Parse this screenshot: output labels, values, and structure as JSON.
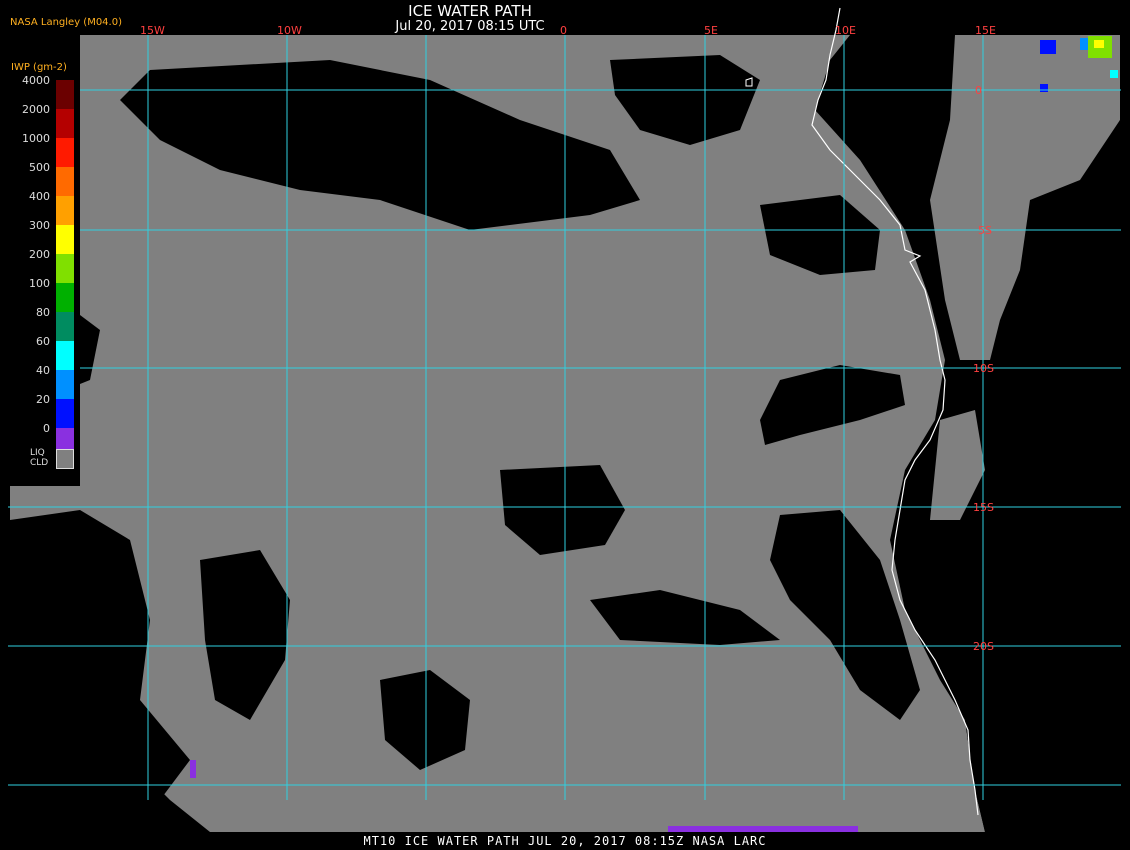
{
  "header": {
    "title": "ICE WATER PATH",
    "subtitle": "Jul 20, 2017 08:15 UTC",
    "credit": "NASA Langley (M04.0)"
  },
  "footer": {
    "text": "MT10  ICE WATER PATH  JUL 20, 2017 08:15Z  NASA LARC"
  },
  "map": {
    "lon_labels": [
      "15W",
      "10W",
      "0",
      "5E",
      "10E",
      "15E"
    ],
    "lat_labels": [
      "0",
      "5S",
      "10S",
      "15S",
      "20S"
    ],
    "colors": {
      "ocean_clear": "#000000",
      "liquid_cloud": "#808080",
      "grid": "#30d0e0",
      "coastline": "#ffffff",
      "grid_label": "#ff4040"
    }
  },
  "legend": {
    "title": "IWP (gm-2)",
    "levels": [
      {
        "label": "4000",
        "color": "#6b0000"
      },
      {
        "label": "2000",
        "color": "#b40000"
      },
      {
        "label": "1000",
        "color": "#ff1a00"
      },
      {
        "label": "500",
        "color": "#ff6a00"
      },
      {
        "label": "400",
        "color": "#ffa000"
      },
      {
        "label": "300",
        "color": "#ffff00"
      },
      {
        "label": "200",
        "color": "#80e000"
      },
      {
        "label": "100",
        "color": "#00b000"
      },
      {
        "label": "80",
        "color": "#008c60"
      },
      {
        "label": "60",
        "color": "#00ffff"
      },
      {
        "label": "40",
        "color": "#0090ff"
      },
      {
        "label": "20",
        "color": "#0010ff"
      },
      {
        "label": "0",
        "color": "#8a30e0"
      }
    ],
    "liquid_label_1": "LIQ",
    "liquid_label_2": "CLD"
  }
}
